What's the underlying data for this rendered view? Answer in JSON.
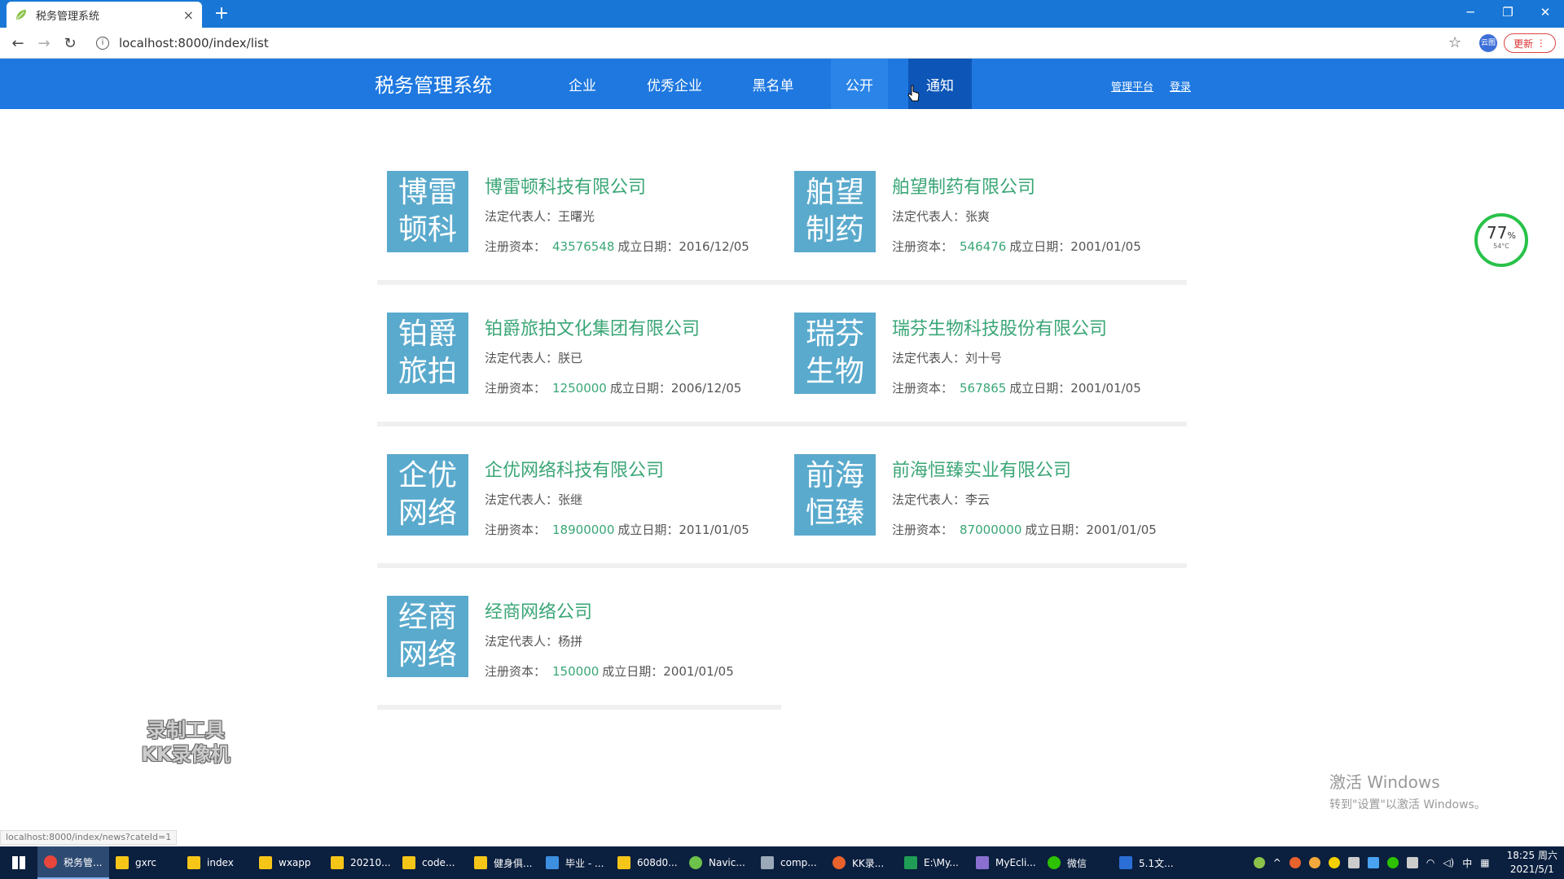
{
  "browser": {
    "tab_title": "税务管理系统",
    "tab_close": "×",
    "new_tab": "+",
    "url": "localhost:8000/index/list",
    "update_label": "更新",
    "profile_label": "云图",
    "status_url": "localhost:8000/index/news?cateId=1"
  },
  "header": {
    "brand": "税务管理系统",
    "nav": [
      "企业",
      "优秀企业",
      "黑名单",
      "公开",
      "通知"
    ],
    "active_nav": "通知",
    "admin_link": "管理平台",
    "login_link": "登录"
  },
  "labels": {
    "legal_rep": "法定代表人：",
    "reg_capital": "注册资本：",
    "founded": "成立日期："
  },
  "companies": [
    {
      "logo_top": "博雷",
      "logo_bottom": "顿科",
      "name": "博雷顿科技有限公司",
      "legal_rep": "王曙光",
      "capital": "43576548",
      "date": "2016/12/05"
    },
    {
      "logo_top": "舶望",
      "logo_bottom": "制药",
      "name": "舶望制药有限公司",
      "legal_rep": "张爽",
      "capital": "546476",
      "date": "2001/01/05"
    },
    {
      "logo_top": "铂爵",
      "logo_bottom": "旅拍",
      "name": "铂爵旅拍文化集团有限公司",
      "legal_rep": "朕已",
      "capital": "1250000",
      "date": "2006/12/05"
    },
    {
      "logo_top": "瑞芬",
      "logo_bottom": "生物",
      "name": "瑞芬生物科技股份有限公司",
      "legal_rep": "刘十号",
      "capital": "567865",
      "date": "2001/01/05"
    },
    {
      "logo_top": "企优",
      "logo_bottom": "网络",
      "name": "企优网络科技有限公司",
      "legal_rep": "张继",
      "capital": "18900000",
      "date": "2011/01/05"
    },
    {
      "logo_top": "前海",
      "logo_bottom": "恒臻",
      "name": "前海恒臻实业有限公司",
      "legal_rep": "李云",
      "capital": "87000000",
      "date": "2001/01/05"
    },
    {
      "logo_top": "经商",
      "logo_bottom": "网络",
      "name": "经商网络公司",
      "legal_rep": "杨拼",
      "capital": "150000",
      "date": "2001/01/05"
    }
  ],
  "gauge": {
    "value": "77",
    "unit": "%",
    "temp": "54°C"
  },
  "overlay": {
    "watermark_line1": "录制工具",
    "watermark_line2": "KK录像机",
    "activate_title": "激活 Windows",
    "activate_hint": "转到\"设置\"以激活 Windows。"
  },
  "taskbar": {
    "items": [
      "税务管...",
      "gxrc",
      "index",
      "wxapp",
      "20210...",
      "code...",
      "健身俱...",
      "毕业 - ...",
      "608d0...",
      "Navic...",
      "comp...",
      "KK录...",
      "E:\\My...",
      "MyEcli...",
      "微信",
      "5.1文..."
    ],
    "time": "18:25 周六",
    "date": "2021/5/1",
    "ime": "中"
  }
}
